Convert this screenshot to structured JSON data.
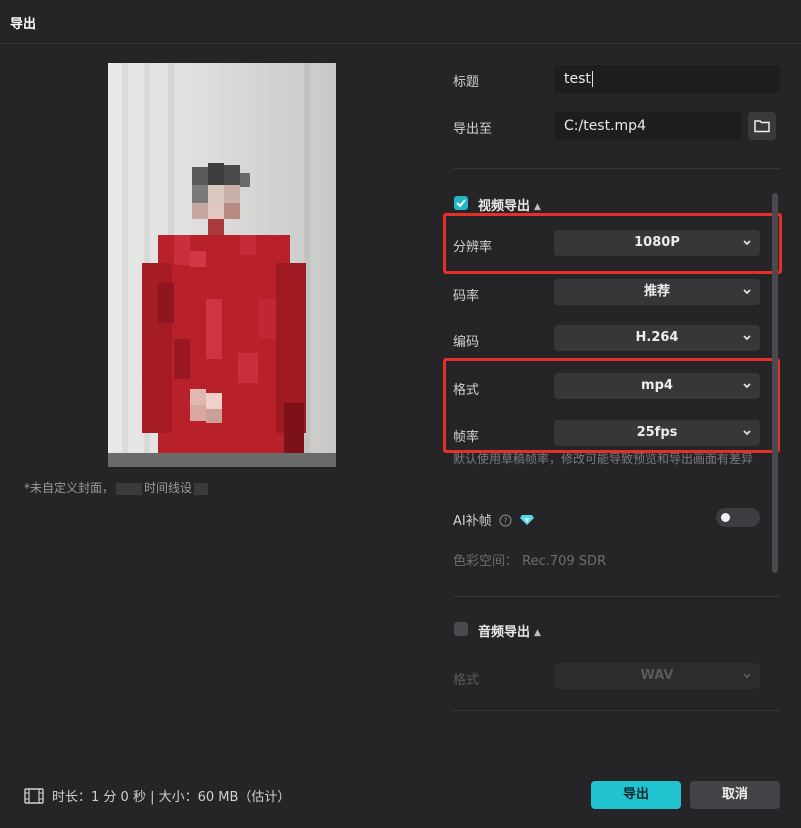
{
  "window": {
    "title": "导出"
  },
  "preview": {
    "cover_note_prefix": "*未自定义封面，",
    "cover_note_mid": "",
    "cover_note_suffix": "时间线设"
  },
  "form": {
    "title_label": "标题",
    "title_value": "test",
    "export_to_label": "导出至",
    "export_to_value": "C:/test.mp4"
  },
  "video_export": {
    "enabled": true,
    "section_label": "视频导出",
    "resolution_label": "分辨率",
    "resolution_value": "1080P",
    "bitrate_label": "码率",
    "bitrate_value": "推荐",
    "codec_label": "编码",
    "codec_value": "H.264",
    "format_label": "格式",
    "format_value": "mp4",
    "framerate_label": "帧率",
    "framerate_value": "25fps",
    "framerate_note": "默认使用草稿帧率，修改可能导致预览和导出画面有差异",
    "ai_frame_label": "AI补帧",
    "ai_frame_enabled": false,
    "colorspace_text": "色彩空间：  Rec.709 SDR"
  },
  "audio_export": {
    "enabled": false,
    "section_label": "音频导出",
    "format_label": "格式",
    "format_value": "WAV"
  },
  "footer": {
    "info": "时长：1 分 0 秒 | 大小：60 MB（估计）",
    "export_button": "导出",
    "cancel_button": "取消"
  },
  "colors": {
    "accent": "#22c3d0",
    "highlight_box": "#e5302a",
    "background": "#252528"
  }
}
